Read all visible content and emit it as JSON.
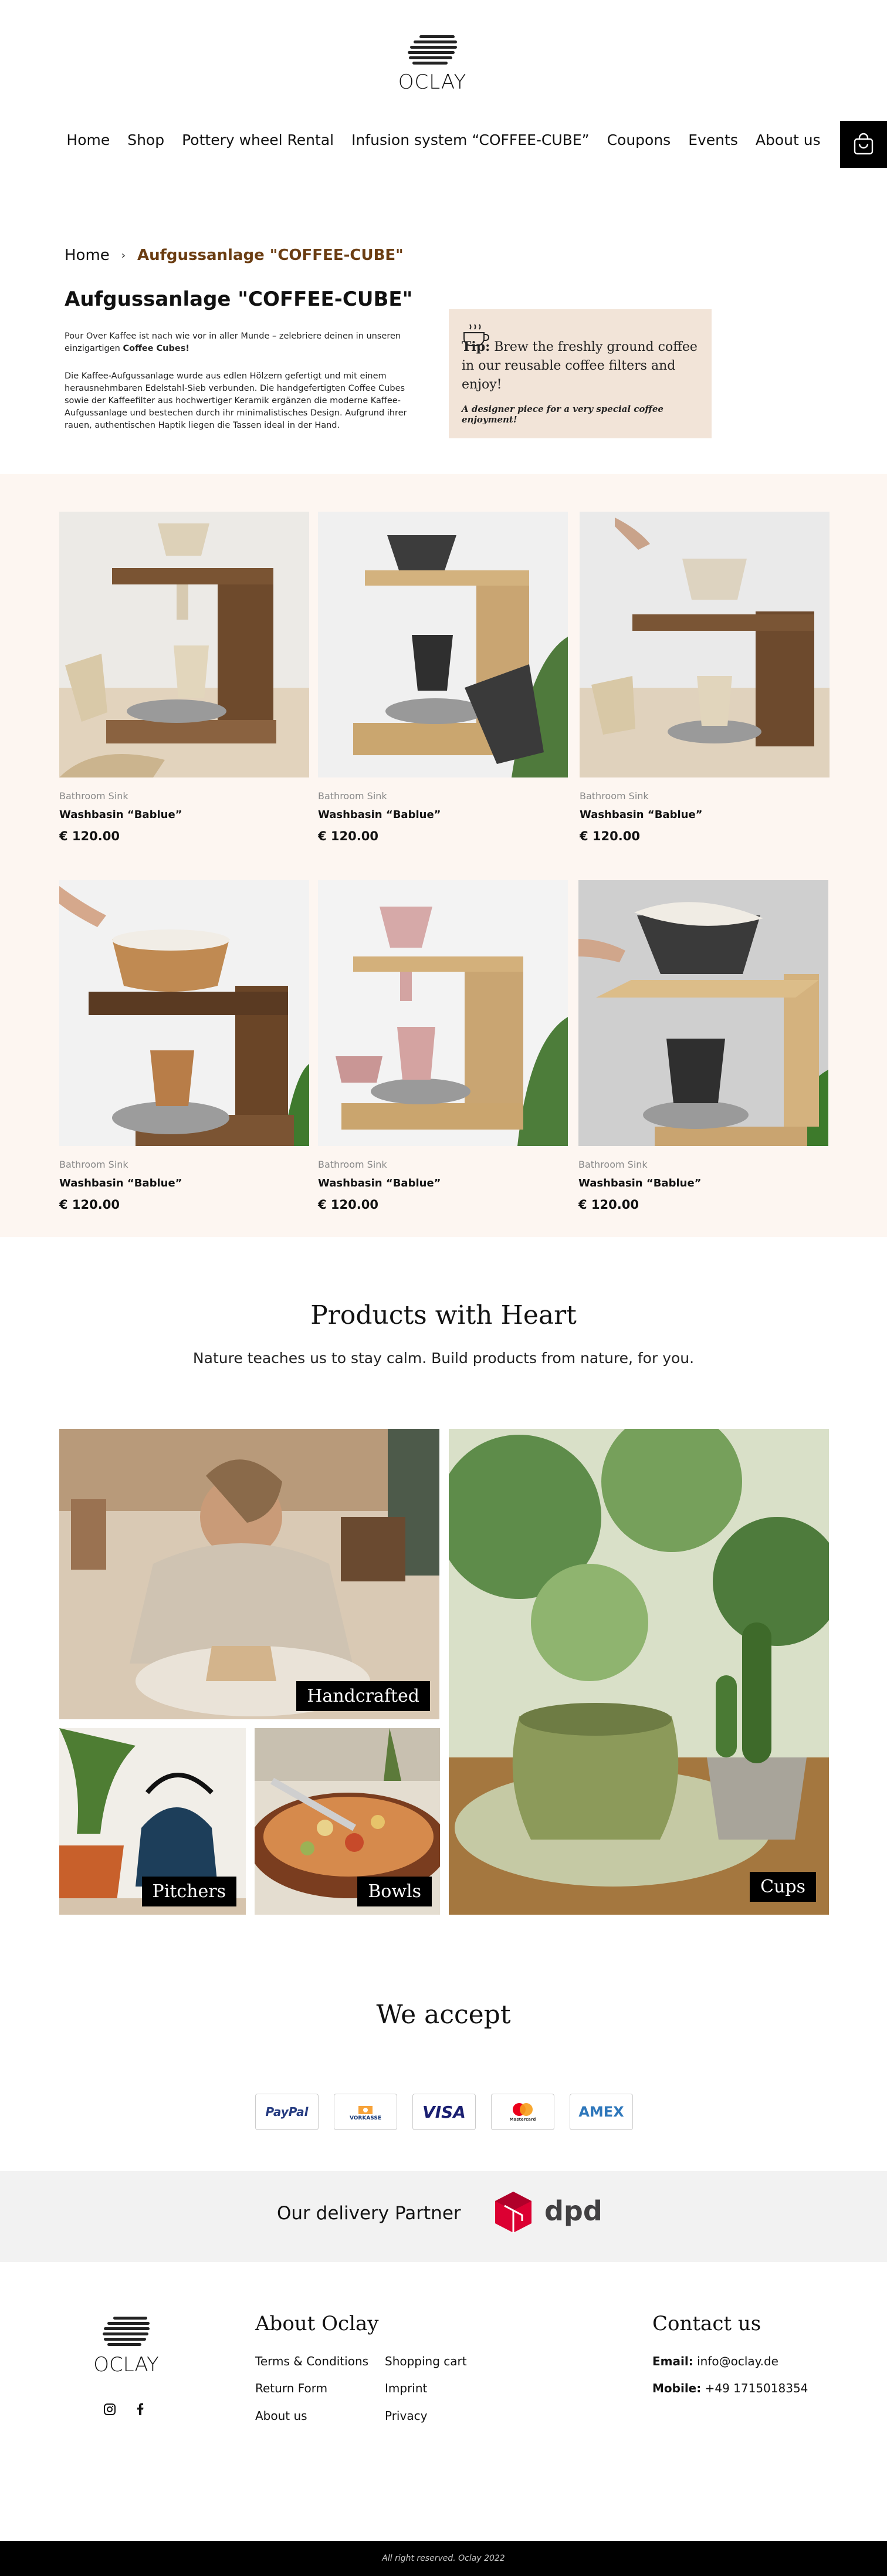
{
  "brand": {
    "name": "OCLAY"
  },
  "nav": {
    "items": [
      "Home",
      "Shop",
      "Pottery wheel Rental",
      "Infusion system “COFFEE-CUBE”",
      "Coupons",
      "Events",
      "About us"
    ]
  },
  "breadcrumb": {
    "home": "Home",
    "current": "Aufgussanlage \"COFFEE-CUBE\""
  },
  "intro": {
    "title": "Aufgussanlage \"COFFEE-CUBE\"",
    "p1_text": "Pour Over Kaffee ist nach wie vor in aller Munde – zelebriere deinen in unseren einzigartigen ",
    "p1_bold": "Coffee Cubes!",
    "p2": "Die Kaffee-Aufgussanlage wurde aus edlen Hölzern gefertigt und mit einem herausnehmbaren Edelstahl-Sieb verbunden. Die handgefertigten Coffee Cubes sowie der Kaffeefilter aus hochwertiger Keramik ergänzen die moderne Kaffee-Aufgussanlage und bestechen durch ihr minimalistisches Design. Aufgrund ihrer rauen, authentischen Haptik liegen die Tassen ideal in der Hand."
  },
  "tip": {
    "label": "Tip:",
    "text": " Brew the freshly ground coffee in our reusable coffee filters and enjoy!",
    "tagline": "A designer piece for a very special coffee enjoyment!"
  },
  "products": [
    {
      "category": "Bathroom Sink",
      "name": "Washbasin “Bablue”",
      "price": "€ 120.00",
      "variant": "cream-walnut"
    },
    {
      "category": "Bathroom Sink",
      "name": "Washbasin “Bablue”",
      "price": "€ 120.00",
      "variant": "black-oak"
    },
    {
      "category": "Bathroom Sink",
      "name": "Washbasin “Bablue”",
      "price": "€ 120.00",
      "variant": "cream-walnut-hand"
    },
    {
      "category": "Bathroom Sink",
      "name": "Washbasin “Bablue”",
      "price": "€ 120.00",
      "variant": "speckled-walnut"
    },
    {
      "category": "Bathroom Sink",
      "name": "Washbasin “Bablue”",
      "price": "€ 120.00",
      "variant": "pink-oak"
    },
    {
      "category": "Bathroom Sink",
      "name": "Washbasin “Bablue”",
      "price": "€ 120.00",
      "variant": "black-oak-pour"
    }
  ],
  "heart": {
    "title": "Products with Heart",
    "subtitle": "Nature teaches us to stay calm. Build products from nature, for you.",
    "tiles": {
      "handcrafted": "Handcrafted",
      "pitchers": "Pitchers",
      "bowls": "Bowls",
      "cups": "Cups"
    }
  },
  "payments": {
    "title": "We accept",
    "methods": [
      "PayPal",
      "VORKASSE",
      "VISA",
      "Mastercard",
      "AMEX"
    ]
  },
  "delivery": {
    "text": "Our delivery Partner",
    "partner": "dpd"
  },
  "footer": {
    "about_title": "About Oclay",
    "links_col1": [
      "Terms & Conditions",
      "Return Form",
      "About us"
    ],
    "links_col2": [
      "Shopping cart",
      "Imprint",
      "Privacy"
    ],
    "contact_title": "Contact us",
    "email_label": "Email:",
    "email": "info@oclay.de",
    "mobile_label": "Mobile:",
    "mobile": "+49 1715018354",
    "copyright": "All right reserved. Oclay 2022"
  },
  "colors": {
    "accent": "#6b3d12",
    "tip_bg": "#f2e4d8",
    "products_bg": "#fdf6f1",
    "dpd_red": "#dc0032"
  }
}
